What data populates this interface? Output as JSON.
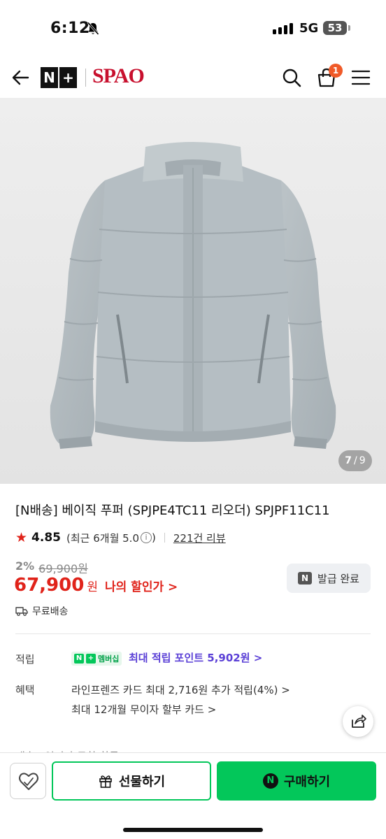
{
  "status_bar": {
    "time": "6:12",
    "network": "5G",
    "battery": "53"
  },
  "header": {
    "logo_nplus_1": "N",
    "logo_nplus_2": "+",
    "brand": "SPAO",
    "cart_count": "1"
  },
  "product_image": {
    "current": "7",
    "separator": "/",
    "total": "9"
  },
  "product": {
    "title": "[N배송] 베이직 푸퍼 (SPJPE4TC11 리오더) SPJPF11C11",
    "rating": "4.85",
    "rating_recent": "(최근 6개월 5.0",
    "rating_close": ")",
    "review_count": "221건 리뷰",
    "discount_rate": "2%",
    "original_price": "69,900원",
    "price": "67,900",
    "currency": "원",
    "my_discount": "나의 할인가 >",
    "coupon_label": "발급 완료",
    "shipping": "무료배송"
  },
  "benefits": {
    "points_label": "적립",
    "member_badge": "멤버십",
    "points_text": "최대 적립 포인트 5,902원 >",
    "benefit_label": "혜택",
    "benefit1": "라인프렌즈 카드 최대 2,716원 추가 적립(4%) >",
    "benefit2": "최대 12개월 무이자 할부 카드 >",
    "cut_row": "배송 · 입니다 도착 확률"
  },
  "bottom_bar": {
    "gift_label": "선물하기",
    "buy_label": "구매하기",
    "buy_icon": "N"
  },
  "icons": [
    "back-arrow-icon",
    "search-icon",
    "cart-icon",
    "hamburger-menu-icon",
    "bell-off-icon",
    "star-icon",
    "info-icon",
    "truck-icon",
    "share-icon",
    "heart-icon",
    "gift-icon"
  ],
  "colors": {
    "brand_red": "#c8102e",
    "price_red": "#e0231a",
    "naver_green": "#03c75a",
    "points_purple": "#5a3fd6",
    "cart_badge": "#f05a28"
  }
}
